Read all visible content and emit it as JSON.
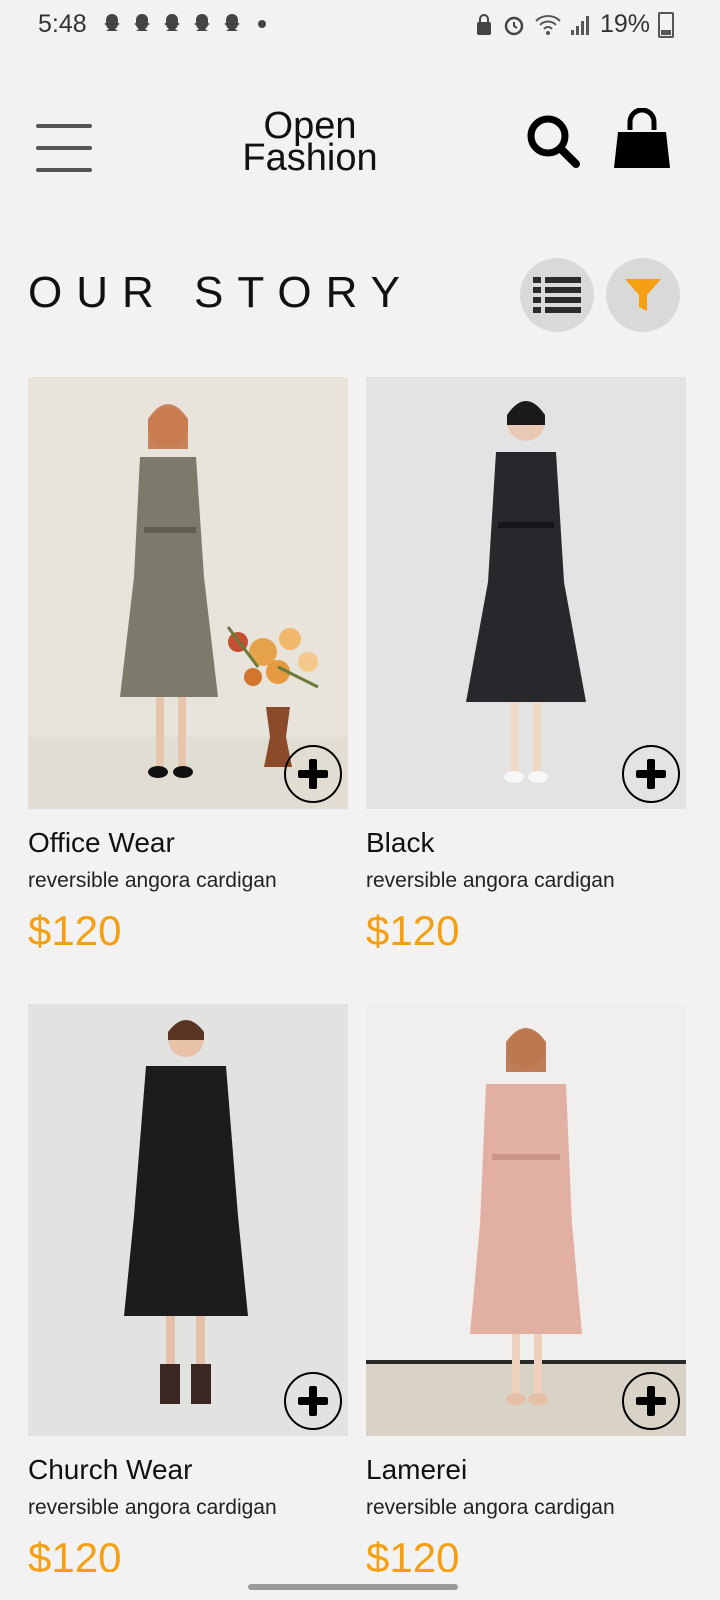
{
  "status": {
    "time": "5:48",
    "battery": "19%"
  },
  "header": {
    "logo_line1": "Open",
    "logo_line2": "Fashion"
  },
  "section": {
    "title": "OUR STORY"
  },
  "accent_color": "#f4a012",
  "products": [
    {
      "name": "Office Wear",
      "desc": "reversible angora cardigan",
      "price": "$120"
    },
    {
      "name": "Black",
      "desc": "reversible angora cardigan",
      "price": "$120"
    },
    {
      "name": "Church Wear",
      "desc": "reversible angora cardigan",
      "price": "$120"
    },
    {
      "name": "Lamerei",
      "desc": "reversible angora cardigan",
      "price": "$120"
    }
  ],
  "icons": [
    "menu-icon",
    "search-icon",
    "shopping-bag-icon",
    "list-view-icon",
    "filter-icon",
    "add-icon"
  ]
}
